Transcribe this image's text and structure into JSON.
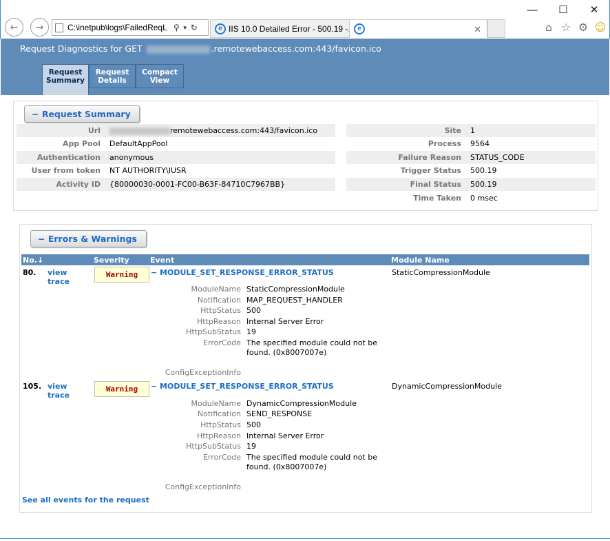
{
  "browser": {
    "address": "C:\\inetpub\\logs\\FailedReqL",
    "tabs": [
      {
        "title": "IIS 10.0 Detailed Error - 500.19 -..."
      },
      {
        "title": ""
      }
    ],
    "window_controls": {
      "minimize": "—",
      "maximize": "☐",
      "close": "✕"
    }
  },
  "header": {
    "title_prefix": "Request Diagnostics for GET",
    "title_suffix": ".remotewebaccess.com:443/favicon.ico"
  },
  "view_tabs": [
    {
      "line1": "Request",
      "line2": "Summary"
    },
    {
      "line1": "Request",
      "line2": "Details"
    },
    {
      "line1": "Compact",
      "line2": "View"
    }
  ],
  "summary": {
    "toggle_label": "−  Request Summary",
    "left": [
      {
        "label": "Url",
        "value": "remotewebaccess.com:443/favicon.ico"
      },
      {
        "label": "App Pool",
        "value": "DefaultAppPool"
      },
      {
        "label": "Authentication",
        "value": "anonymous"
      },
      {
        "label": "User from token",
        "value": "NT AUTHORITY\\IUSR"
      },
      {
        "label": "Activity ID",
        "value": "{80000030-0001-FC00-B63F-84710C7967BB}"
      }
    ],
    "right": [
      {
        "label": "Site",
        "value": "1"
      },
      {
        "label": "Process",
        "value": "9564"
      },
      {
        "label": "Failure Reason",
        "value": "STATUS_CODE"
      },
      {
        "label": "Trigger Status",
        "value": "500.19"
      },
      {
        "label": "Final Status",
        "value": "500.19"
      },
      {
        "label": "Time Taken",
        "value": "0 msec"
      }
    ]
  },
  "errors": {
    "toggle_label": "−  Errors & Warnings",
    "columns": {
      "no": "No.↓",
      "severity": "Severity",
      "event": "Event",
      "module": "Module Name"
    },
    "events": [
      {
        "number": "80.",
        "link1": "view",
        "link2": "trace",
        "severity": "Warning",
        "name": "−  MODULE_SET_RESPONSE_ERROR_STATUS",
        "module": "StaticCompressionModule",
        "details": [
          {
            "label": "ModuleName",
            "value": "StaticCompressionModule"
          },
          {
            "label": "Notification",
            "value": "MAP_REQUEST_HANDLER"
          },
          {
            "label": "HttpStatus",
            "value": "500"
          },
          {
            "label": "HttpReason",
            "value": "Internal Server Error"
          },
          {
            "label": "HttpSubStatus",
            "value": "19"
          },
          {
            "label": "ErrorCode",
            "value": "The specified module could not be found. (0x8007007e)"
          },
          {
            "label": "ConfigExceptionInfo",
            "value": ""
          }
        ]
      },
      {
        "number": "105.",
        "link1": "view",
        "link2": "trace",
        "severity": "Warning",
        "name": "−  MODULE_SET_RESPONSE_ERROR_STATUS",
        "module": "DynamicCompressionModule",
        "details": [
          {
            "label": "ModuleName",
            "value": "DynamicCompressionModule"
          },
          {
            "label": "Notification",
            "value": "SEND_RESPONSE"
          },
          {
            "label": "HttpStatus",
            "value": "500"
          },
          {
            "label": "HttpReason",
            "value": "Internal Server Error"
          },
          {
            "label": "HttpSubStatus",
            "value": "19"
          },
          {
            "label": "ErrorCode",
            "value": "The specified module could not be found. (0x8007007e)"
          },
          {
            "label": "ConfigExceptionInfo",
            "value": ""
          }
        ]
      }
    ],
    "see_all_label": "See all events for the request"
  },
  "colors": {
    "header_blue": "#5f8bb9",
    "link_blue": "#1a6fc4",
    "warning_bg": "#ffffd8",
    "warning_text": "#b20000"
  }
}
